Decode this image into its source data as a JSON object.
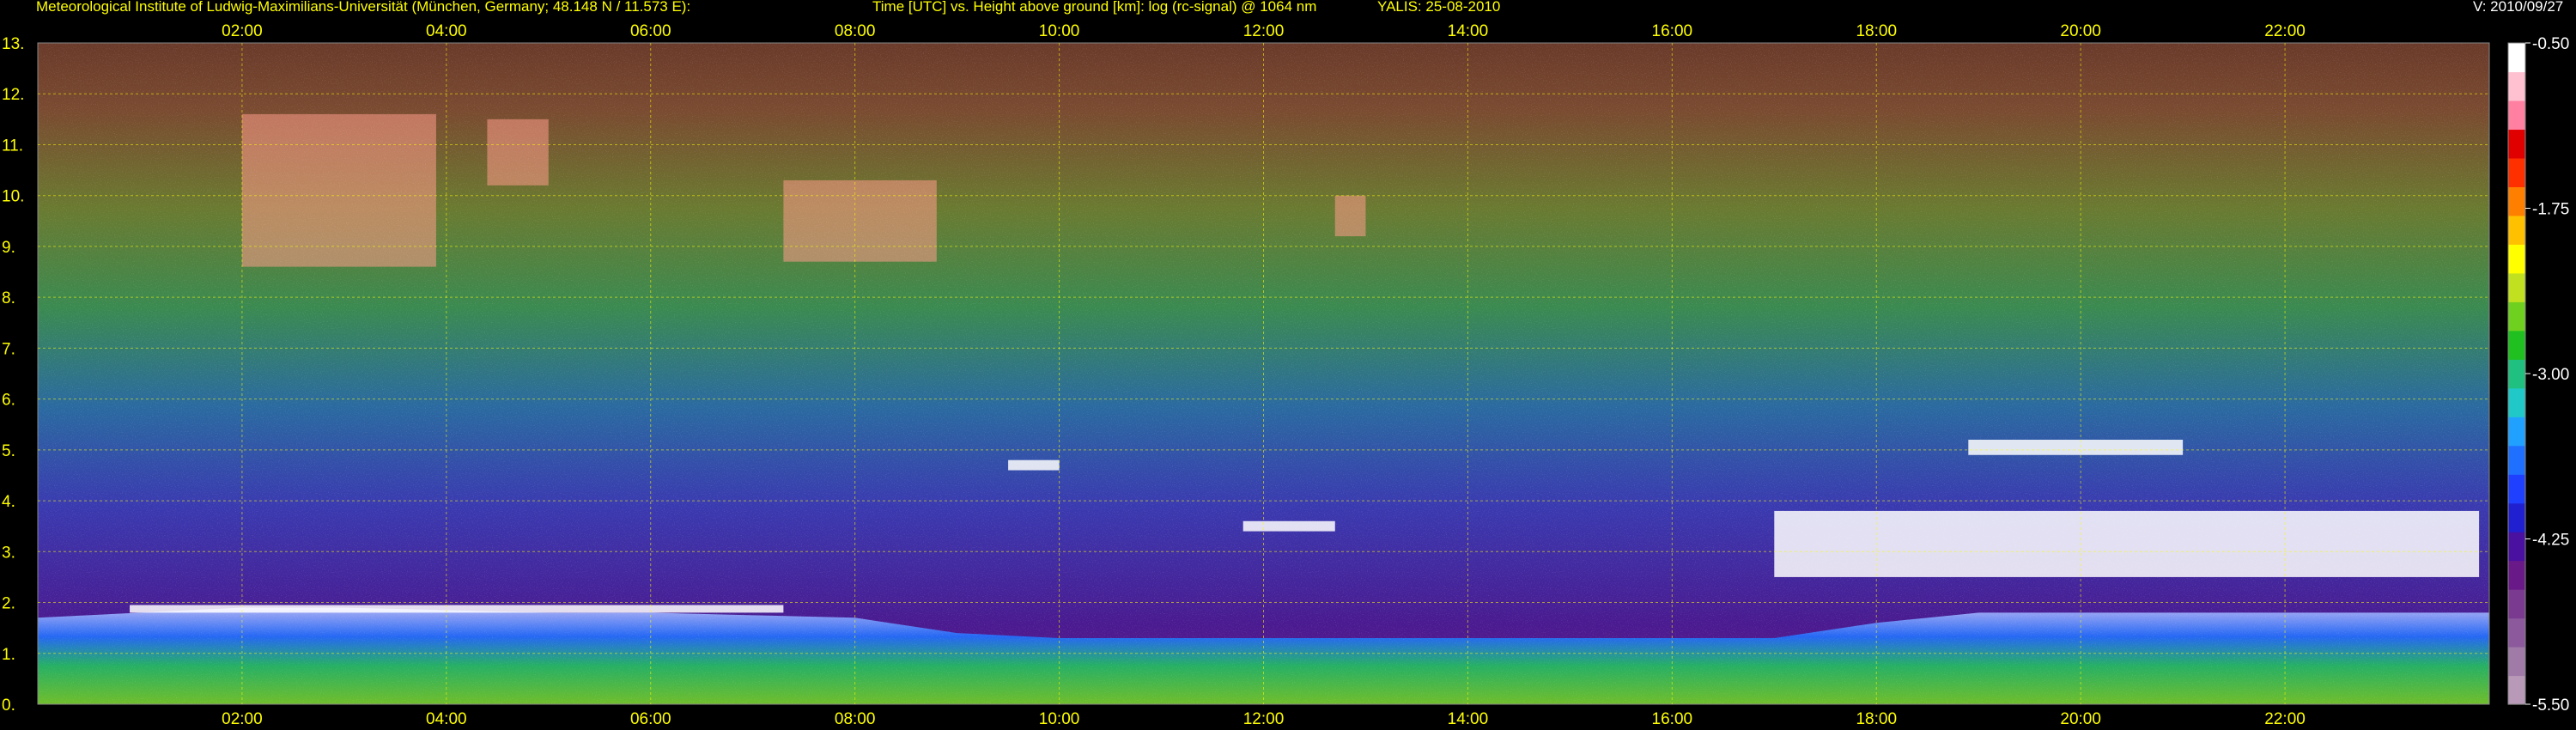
{
  "header": {
    "institute": "Meteorological Institute of Ludwig-Maximilians-Universität (München, Germany; 48.148 N / 11.573 E):",
    "description": "Time [UTC] vs. Height above ground [km]: log (rc-signal) @ 1064 nm",
    "instrument_date": "YALIS: 25-08-2010",
    "version": "V: 2010/09/27"
  },
  "chart_data": {
    "type": "heatmap",
    "title": "Time [UTC] vs. Height above ground [km]: log (rc-signal) @ 1064 nm",
    "xlabel": "Time [UTC]",
    "ylabel": "Height above ground [km]",
    "xlim": [
      0,
      24
    ],
    "ylim": [
      0,
      13
    ],
    "x_ticks": [
      2,
      4,
      6,
      8,
      10,
      12,
      14,
      16,
      18,
      20,
      22
    ],
    "x_tick_labels": [
      "02:00",
      "04:00",
      "06:00",
      "08:00",
      "10:00",
      "12:00",
      "14:00",
      "16:00",
      "18:00",
      "20:00",
      "22:00"
    ],
    "y_ticks": [
      0,
      1,
      2,
      3,
      4,
      5,
      6,
      7,
      8,
      9,
      10,
      11,
      12,
      13
    ],
    "y_tick_labels": [
      "0.",
      "1.",
      "2.",
      "3.",
      "4.",
      "5.",
      "6.",
      "7.",
      "8.",
      "9.",
      "10.",
      "11.",
      "12.",
      "13."
    ],
    "grid": true,
    "colorbar": {
      "range": [
        -5.5,
        -0.5
      ],
      "tick_values": [
        -0.5,
        -1.75,
        -3.0,
        -4.25,
        -5.5
      ],
      "tick_labels": [
        "-0.50",
        "-1.75",
        "-3.00",
        "-4.25",
        "-5.50"
      ],
      "colors": [
        "#b89ab8",
        "#a07ba8",
        "#8c5a9c",
        "#7a3a90",
        "#6a1a88",
        "#4a10a0",
        "#2020d0",
        "#2040ff",
        "#2070ff",
        "#20a0ff",
        "#20c8c8",
        "#20c080",
        "#20c020",
        "#70d020",
        "#c0e020",
        "#ffff00",
        "#ffc000",
        "#ff8000",
        "#ff3000",
        "#e00000",
        "#ff80a0",
        "#ffc0d0",
        "#ffffff"
      ]
    },
    "boundary_layer_top_km": [
      {
        "t": 0.0,
        "h": 1.7
      },
      {
        "t": 1.0,
        "h": 1.8
      },
      {
        "t": 2.0,
        "h": 1.9
      },
      {
        "t": 3.0,
        "h": 1.9
      },
      {
        "t": 4.0,
        "h": 1.85
      },
      {
        "t": 5.0,
        "h": 1.8
      },
      {
        "t": 6.0,
        "h": 1.8
      },
      {
        "t": 7.0,
        "h": 1.75
      },
      {
        "t": 8.0,
        "h": 1.7
      },
      {
        "t": 9.0,
        "h": 1.4
      },
      {
        "t": 10.0,
        "h": 1.3
      },
      {
        "t": 11.0,
        "h": 1.3
      },
      {
        "t": 12.0,
        "h": 1.3
      },
      {
        "t": 13.0,
        "h": 1.3
      },
      {
        "t": 14.0,
        "h": 1.3
      },
      {
        "t": 16.0,
        "h": 1.3
      },
      {
        "t": 17.0,
        "h": 1.3
      },
      {
        "t": 18.0,
        "h": 1.6
      },
      {
        "t": 19.0,
        "h": 1.8
      },
      {
        "t": 20.0,
        "h": 1.8
      },
      {
        "t": 21.0,
        "h": 1.8
      },
      {
        "t": 22.0,
        "h": 1.8
      },
      {
        "t": 23.0,
        "h": 1.8
      },
      {
        "t": 24.0,
        "h": 1.8
      }
    ],
    "cloud_layers": [
      {
        "t_start": 2.0,
        "t_end": 3.9,
        "h_bottom": 8.6,
        "h_top": 11.6,
        "kind": "cirrus"
      },
      {
        "t_start": 4.4,
        "t_end": 5.0,
        "h_bottom": 10.2,
        "h_top": 11.5,
        "kind": "cirrus"
      },
      {
        "t_start": 7.3,
        "t_end": 8.8,
        "h_bottom": 8.7,
        "h_top": 10.3,
        "kind": "cirrus"
      },
      {
        "t_start": 12.7,
        "t_end": 13.0,
        "h_bottom": 9.2,
        "h_top": 10.0,
        "kind": "cirrus"
      },
      {
        "t_start": 9.5,
        "t_end": 10.0,
        "h_bottom": 4.6,
        "h_top": 4.8,
        "kind": "mid-level"
      },
      {
        "t_start": 11.8,
        "t_end": 12.7,
        "h_bottom": 3.4,
        "h_top": 3.6,
        "kind": "mid-level"
      },
      {
        "t_start": 17.0,
        "t_end": 23.9,
        "h_bottom": 2.5,
        "h_top": 3.8,
        "kind": "mid-level"
      },
      {
        "t_start": 18.9,
        "t_end": 21.0,
        "h_bottom": 4.9,
        "h_top": 5.2,
        "kind": "mid-level"
      },
      {
        "t_start": 0.9,
        "t_end": 7.3,
        "h_bottom": 1.8,
        "h_top": 1.95,
        "kind": "boundary-layer top"
      }
    ]
  }
}
